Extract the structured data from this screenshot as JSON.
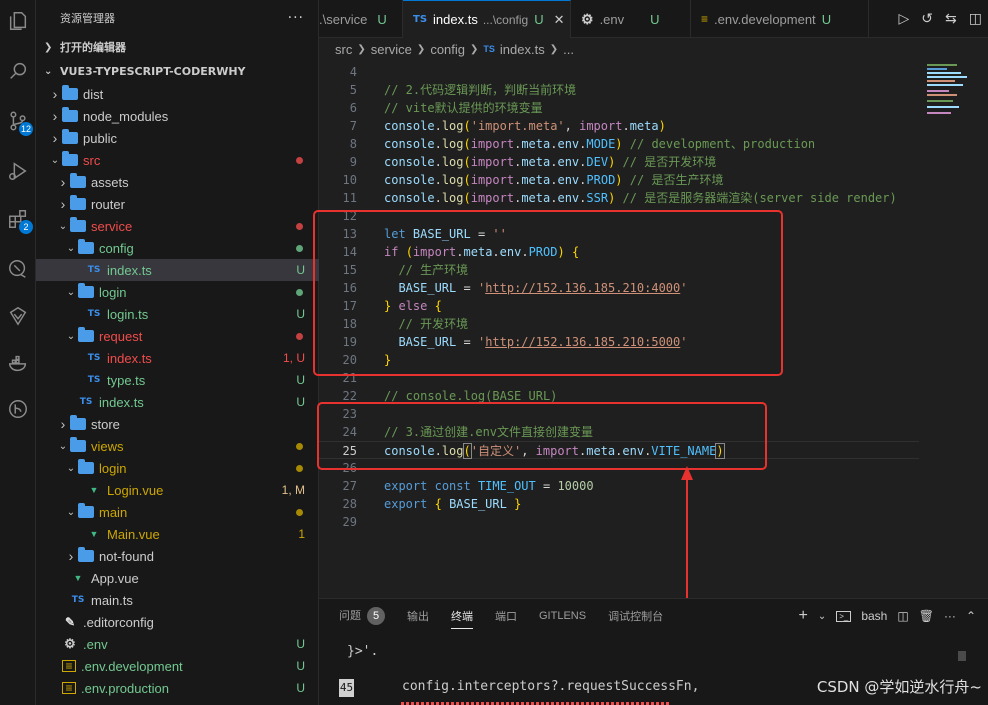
{
  "activity_bar": {
    "source_control_badge": "12",
    "extensions_badge": "2"
  },
  "sidebar": {
    "title": "资源管理器",
    "more": "···",
    "open_editors": "打开的编辑器",
    "project": "VUE3-TYPESCRIPT-CODERWHY",
    "tree": [
      {
        "label": "dist",
        "type": "folder-closed"
      },
      {
        "label": "node_modules",
        "type": "folder-closed"
      },
      {
        "label": "public",
        "type": "folder-closed"
      },
      {
        "label": "src",
        "type": "folder-open",
        "dot": "#f14c4c"
      },
      {
        "label": "assets",
        "type": "folder-closed"
      },
      {
        "label": "router",
        "type": "folder-closed"
      },
      {
        "label": "service",
        "type": "folder-open",
        "dot": "#f14c4c"
      },
      {
        "label": "config",
        "type": "folder-open",
        "dot": "#73c991"
      },
      {
        "label": "index.ts",
        "type": "ts",
        "badge": "U",
        "selected": true
      },
      {
        "label": "login",
        "type": "folder-open",
        "dot": "#73c991"
      },
      {
        "label": "login.ts",
        "type": "ts",
        "badge": "U"
      },
      {
        "label": "request",
        "type": "folder-open",
        "dot": "#f14c4c"
      },
      {
        "label": "index.ts",
        "type": "ts",
        "badge": "1, U"
      },
      {
        "label": "type.ts",
        "type": "ts",
        "badge": "U"
      },
      {
        "label": "index.ts",
        "type": "ts",
        "badge": "U"
      },
      {
        "label": "store",
        "type": "folder-closed"
      },
      {
        "label": "views",
        "type": "folder-open",
        "dot": "#cca700"
      },
      {
        "label": "login",
        "type": "folder-open",
        "dot": "#cca700"
      },
      {
        "label": "Login.vue",
        "type": "vue",
        "badge": "1, M"
      },
      {
        "label": "main",
        "type": "folder-open",
        "dot": "#cca700"
      },
      {
        "label": "Main.vue",
        "type": "vue",
        "badge": "1"
      },
      {
        "label": "not-found",
        "type": "folder-closed"
      },
      {
        "label": "App.vue",
        "type": "vue"
      },
      {
        "label": "main.ts",
        "type": "ts"
      },
      {
        "label": ".editorconfig",
        "type": "config"
      },
      {
        "label": ".env",
        "type": "gear",
        "badge": "U"
      },
      {
        "label": ".env.development",
        "type": "env",
        "badge": "U"
      },
      {
        "label": ".env.production",
        "type": "env",
        "badge": "U"
      }
    ]
  },
  "tabs": [
    {
      "label": ".\\service",
      "badge": "U",
      "icon": ""
    },
    {
      "label": "index.ts",
      "detail": "...\\config",
      "badge": "U",
      "icon": "TS",
      "active": true,
      "close": "✕"
    },
    {
      "label": ".env",
      "badge": "U",
      "icon": "⚙"
    },
    {
      "label": ".env.development",
      "badge": "U",
      "icon": "≡"
    }
  ],
  "breadcrumb": {
    "parts": [
      "src",
      "service",
      "config"
    ],
    "file_icon": "TS",
    "file": "index.ts",
    "ellipsis": "..."
  },
  "editor": {
    "current_line": 25,
    "lines": [
      {
        "n": 4,
        "html": ""
      },
      {
        "n": 5,
        "html": "<span class='cmt'>// 2.代码逻辑判断，判断当前环境</span>"
      },
      {
        "n": 6,
        "html": "<span class='cmt'>// vite默认提供的环境变量</span>"
      },
      {
        "n": 7,
        "html": "<span class='var'>console</span><span class='pn'>.</span><span class='fn'>log</span><span class='br1'>(</span><span class='str'>'import.meta'</span><span class='pn'>, </span><span class='kw2'>import</span><span class='pn'>.</span><span class='var'>meta</span><span class='br1'>)</span>"
      },
      {
        "n": 8,
        "html": "<span class='var'>console</span><span class='pn'>.</span><span class='fn'>log</span><span class='br1'>(</span><span class='kw2'>import</span><span class='pn'>.</span><span class='var'>meta</span><span class='pn'>.</span><span class='var'>env</span><span class='pn'>.</span><span class='const'>MODE</span><span class='br1'>)</span> <span class='cmt'>// development、production</span>"
      },
      {
        "n": 9,
        "html": "<span class='var'>console</span><span class='pn'>.</span><span class='fn'>log</span><span class='br1'>(</span><span class='kw2'>import</span><span class='pn'>.</span><span class='var'>meta</span><span class='pn'>.</span><span class='var'>env</span><span class='pn'>.</span><span class='const'>DEV</span><span class='br1'>)</span> <span class='cmt'>// 是否开发环境</span>"
      },
      {
        "n": 10,
        "html": "<span class='var'>console</span><span class='pn'>.</span><span class='fn'>log</span><span class='br1'>(</span><span class='kw2'>import</span><span class='pn'>.</span><span class='var'>meta</span><span class='pn'>.</span><span class='var'>env</span><span class='pn'>.</span><span class='const'>PROD</span><span class='br1'>)</span> <span class='cmt'>// 是否生产环境</span>"
      },
      {
        "n": 11,
        "html": "<span class='var'>console</span><span class='pn'>.</span><span class='fn'>log</span><span class='br1'>(</span><span class='kw2'>import</span><span class='pn'>.</span><span class='var'>meta</span><span class='pn'>.</span><span class='var'>env</span><span class='pn'>.</span><span class='const'>SSR</span><span class='br1'>)</span> <span class='cmt'>// 是否是服务器端渲染(server side render)</span>"
      },
      {
        "n": 12,
        "html": ""
      },
      {
        "n": 13,
        "html": "<span class='kw'>let</span> <span class='var'>BASE_URL</span> <span class='pn'>=</span> <span class='str'>''</span>"
      },
      {
        "n": 14,
        "html": "<span class='kw2'>if</span> <span class='br1'>(</span><span class='kw2'>import</span><span class='pn'>.</span><span class='var'>meta</span><span class='pn'>.</span><span class='var'>env</span><span class='pn'>.</span><span class='const'>PROD</span><span class='br1'>)</span> <span class='br1'>{</span>"
      },
      {
        "n": 15,
        "html": "  <span class='cmt'>// 生产环境</span>"
      },
      {
        "n": 16,
        "html": "  <span class='var'>BASE_URL</span> <span class='pn'>=</span> <span class='str'>'</span><span class='strlink'>http://152.136.185.210:4000</span><span class='str'>'</span>"
      },
      {
        "n": 17,
        "html": "<span class='br1'>}</span> <span class='kw2'>else</span> <span class='br1'>{</span>"
      },
      {
        "n": 18,
        "html": "  <span class='cmt'>// 开发环境</span>"
      },
      {
        "n": 19,
        "html": "  <span class='var'>BASE_URL</span> <span class='pn'>=</span> <span class='str'>'</span><span class='strlink'>http://152.136.185.210:5000</span><span class='str'>'</span>"
      },
      {
        "n": 20,
        "html": "<span class='br1'>}</span>"
      },
      {
        "n": 21,
        "html": ""
      },
      {
        "n": 22,
        "html": "<span class='cmt'>// console.log(BASE_URL)</span>"
      },
      {
        "n": 23,
        "html": ""
      },
      {
        "n": 24,
        "html": "<span class='cmt'>// 3.通过创建.env文件直接创建变量</span>"
      },
      {
        "n": 25,
        "html": "<span class='var'>console</span><span class='pn'>.</span><span class='fn'>log</span><span class='br1' style='outline:1px solid #888'>(</span><span class='str'>'自定义'</span><span class='pn'>, </span><span class='kw2'>import</span><span class='pn'>.</span><span class='var'>meta</span><span class='pn'>.</span><span class='var'>env</span><span class='pn'>.</span><span class='const'>VITE_NAME</span><span class='br1' style='outline:1px solid #888'>)</span>"
      },
      {
        "n": 26,
        "html": ""
      },
      {
        "n": 27,
        "html": "<span class='kw'>export</span> <span class='kw'>const</span> <span class='const'>TIME_OUT</span> <span class='pn'>=</span> <span class='num'>10000</span>"
      },
      {
        "n": 28,
        "html": "<span class='kw'>export</span> <span class='br1'>{</span> <span class='var'>BASE_URL</span> <span class='br1'>}</span>"
      },
      {
        "n": 29,
        "html": ""
      }
    ]
  },
  "panel": {
    "tabs": [
      "问题",
      "输出",
      "终端",
      "端口",
      "GITLENS",
      "调试控制台"
    ],
    "problems_count": "5",
    "active_tab": "终端",
    "shell": "bash",
    "terminal_lines": [
      "}>'.",
      "config.interceptors?.requestSuccessFn,"
    ],
    "line_number": "45"
  },
  "watermark": "CSDN @学如逆水行舟~"
}
